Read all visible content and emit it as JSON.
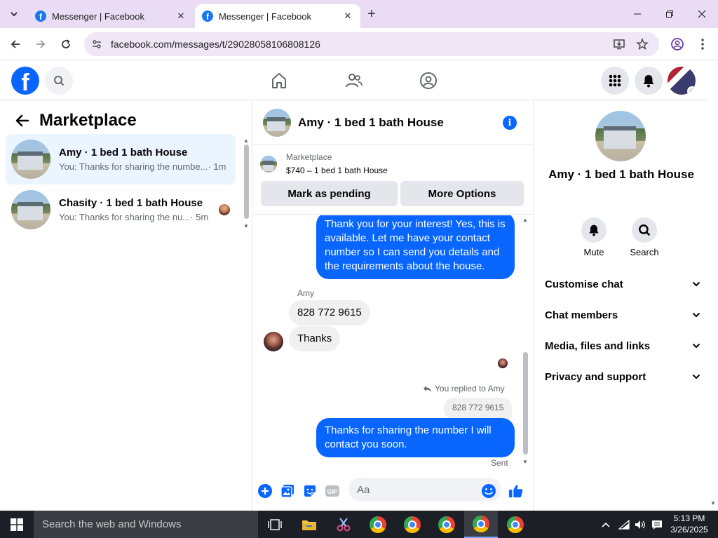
{
  "browser": {
    "tabs": [
      {
        "title": "Messenger | Facebook",
        "active": false
      },
      {
        "title": "Messenger | Facebook",
        "active": true
      }
    ],
    "url": "facebook.com/messages/t/29028058106808126"
  },
  "fb_nav": {
    "logo": "f",
    "icons": [
      "search-icon",
      "home-icon",
      "friends-icon",
      "groups-icon",
      "menu-grid-icon",
      "bell-icon"
    ]
  },
  "left_panel": {
    "title": "Marketplace",
    "chats": [
      {
        "name": "Amy · 1 bed 1 bath House",
        "preview": "You: Thanks for sharing the numbe...",
        "time": " · 1m",
        "selected": true
      },
      {
        "name": "Chasity · 1 bed 1 bath House",
        "preview": "You: Thanks for sharing the nu...",
        "time": " · 5m",
        "selected": false
      }
    ]
  },
  "conversation": {
    "title": "Amy · 1 bed 1 bath House",
    "listing": {
      "source": "Marketplace",
      "title": "$740 – 1 bed 1 bath House",
      "buttons": [
        "Mark as pending",
        "More Options"
      ]
    },
    "messages": {
      "outgoing_1": "Thank you for your interest! Yes, this is available. Let me have your contact number so I can send you details and the requirements about the house.",
      "incoming_sender": "Amy",
      "incoming_1": "828 772 9615",
      "incoming_2": "Thanks",
      "replied_label": "You replied to Amy",
      "quoted": "828 772 9615",
      "outgoing_2": "Thanks for sharing the number I will contact you soon.",
      "status": "Sent"
    },
    "composer": {
      "placeholder": "Aa"
    }
  },
  "right_panel": {
    "name": "Amy · 1 bed 1 bath House",
    "actions": [
      {
        "label": "Mute",
        "icon": "bell-icon"
      },
      {
        "label": "Search",
        "icon": "search-icon"
      }
    ],
    "sections": [
      "Customise chat",
      "Chat members",
      "Media, files and links",
      "Privacy and support"
    ]
  },
  "taskbar": {
    "search_placeholder": "Search the web and Windows",
    "time": "5:13 PM",
    "date": "3/26/2025"
  },
  "colors": {
    "accent": "#0866ff",
    "bubble_in": "#f0f0f0",
    "selected_chat": "#ebf5ff",
    "tab_strip": "#e9dcf4"
  }
}
